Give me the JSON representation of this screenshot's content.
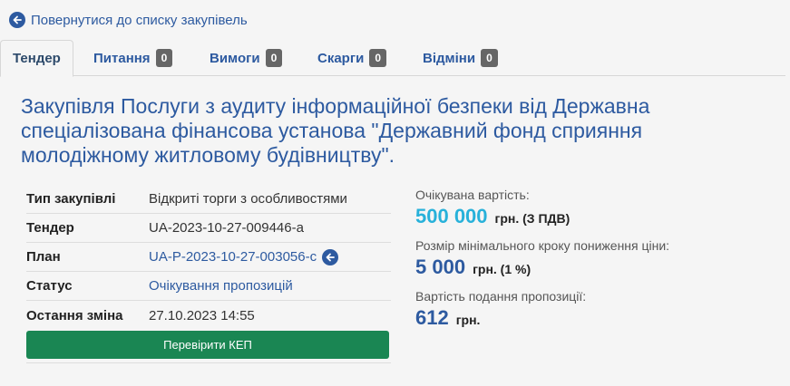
{
  "back_link": {
    "label": "Повернутися до списку закупівель",
    "icon": "arrow-left-icon"
  },
  "tabs": [
    {
      "label": "Тендер",
      "count": null,
      "active": true
    },
    {
      "label": "Питання",
      "count": "0"
    },
    {
      "label": "Вимоги",
      "count": "0"
    },
    {
      "label": "Скарги",
      "count": "0"
    },
    {
      "label": "Відміни",
      "count": "0"
    }
  ],
  "title": "Закупівля Послуги з аудиту інформаційної безпеки від Державна спеціалізована фінансова установа \"Державний фонд сприяння молодіжному житловому будівництву\".",
  "info": [
    {
      "key": "Тип закупівлі",
      "value": "Відкриті торги з особливостями"
    },
    {
      "key": "Тендер",
      "value": "UA-2023-10-27-009446-a"
    },
    {
      "key": "План",
      "value": "UA-P-2023-10-27-003056-c"
    },
    {
      "key": "Статус",
      "value": "Очікування пропозицій"
    },
    {
      "key": "Остання зміна",
      "value": "27.10.2023 14:55"
    }
  ],
  "kep_button": "Перевірити КЕП",
  "prices": [
    {
      "label": "Очікувана вартість:",
      "amount": "500 000",
      "unit": "грн. (З ПДВ)"
    },
    {
      "label": "Розмір мінімального кроку пониження ціни:",
      "amount": "5 000",
      "unit": "грн. (1 %)"
    },
    {
      "label": "Вартість подання пропозиції:",
      "amount": "612",
      "unit": "грн."
    }
  ],
  "colors": {
    "link": "#2d5aa0",
    "accent_cyan": "#27b1da",
    "button_green": "#1a8653",
    "badge": "#666666"
  }
}
